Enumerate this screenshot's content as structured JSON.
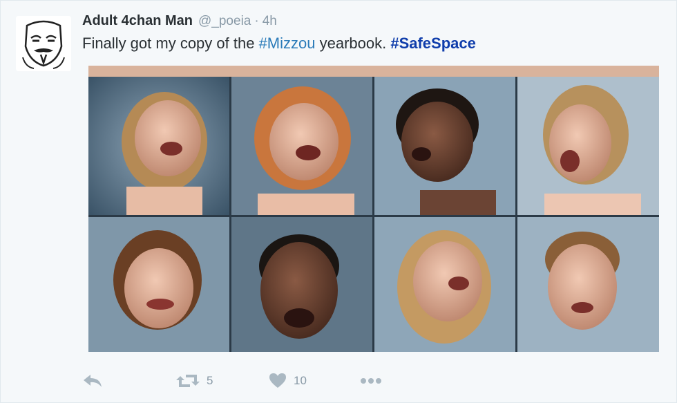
{
  "tweet": {
    "author_name": "Adult 4chan Man",
    "handle": "@_poeia",
    "separator": "·",
    "time": "4h",
    "text_parts": {
      "t1": "Finally got my copy of the ",
      "hashtag1": "#Mizzou",
      "t2": " yearbook. ",
      "hashtag2": "#SafeSpace"
    },
    "avatar_icon": "guy-fawkes-mask-icon",
    "media": {
      "description_icon": "photo-grid",
      "tiles": 8
    }
  },
  "actions": {
    "reply_icon": "reply-icon",
    "retweet_icon": "retweet-icon",
    "retweet_count": "5",
    "like_icon": "heart-icon",
    "like_count": "10",
    "more_icon": "more-icon"
  },
  "colors": {
    "background": "#f5f8fa",
    "hashtag": "#2b7bb9",
    "hashtag_bold": "#0f3dab",
    "muted": "#aab8c2"
  }
}
